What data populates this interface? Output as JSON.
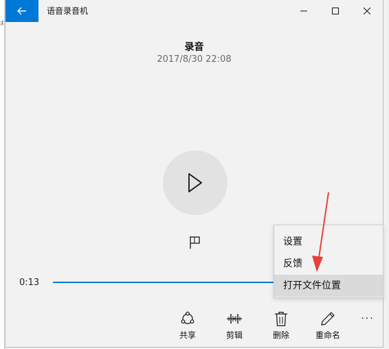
{
  "window": {
    "title": "语音录音机",
    "accent": "#0078d7"
  },
  "recording": {
    "title": "录音",
    "date": "2017/8/30 22:08"
  },
  "player": {
    "current_time": "0:13"
  },
  "menu": {
    "items": [
      {
        "label": "设置"
      },
      {
        "label": "反馈"
      },
      {
        "label": "打开文件位置"
      }
    ],
    "highlighted": "打开文件位置"
  },
  "toolbar": {
    "share_label": "共享",
    "trim_label": "剪辑",
    "delete_label": "删除",
    "rename_label": "重命名",
    "more_label": "···"
  },
  "annotation": {
    "arrow_color": "#e8403a"
  },
  "icons": [
    "back-arrow-icon",
    "minimize-icon",
    "maximize-icon",
    "close-icon",
    "play-icon",
    "flag-icon",
    "share-icon",
    "trim-icon",
    "delete-icon",
    "rename-icon",
    "more-icon"
  ]
}
